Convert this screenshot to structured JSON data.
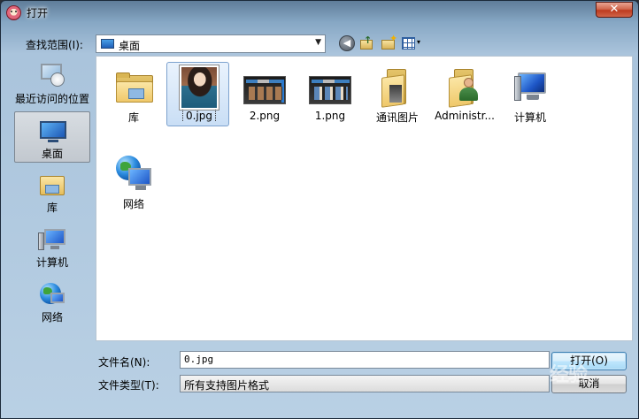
{
  "window": {
    "title": "打开",
    "close_label": "✕"
  },
  "toolbar": {
    "look_in_label": "查找范围(I):",
    "look_in_value": "桌面",
    "back_glyph": "◀",
    "views_dropdown_glyph": "▾"
  },
  "places": [
    {
      "label": "最近访问的位置",
      "icon": "recent-places-icon",
      "selected": false
    },
    {
      "label": "桌面",
      "icon": "desktop-icon",
      "selected": true
    },
    {
      "label": "库",
      "icon": "libraries-icon",
      "selected": false
    },
    {
      "label": "计算机",
      "icon": "computer-icon",
      "selected": false
    },
    {
      "label": "网络",
      "icon": "network-icon",
      "selected": false
    }
  ],
  "files": [
    {
      "label": "库",
      "icon": "libraries-folder-icon"
    },
    {
      "label": "0.jpg",
      "icon": "photo-thumbnail-icon",
      "selected": true
    },
    {
      "label": "2.png",
      "icon": "image-thumbnail-icon"
    },
    {
      "label": "1.png",
      "icon": "image-thumbnail-icon"
    },
    {
      "label": "通讯图片",
      "icon": "folder-icon"
    },
    {
      "label": "Administr...",
      "icon": "user-folder-icon"
    },
    {
      "label": "计算机",
      "icon": "computer-icon"
    },
    {
      "label": "网络",
      "icon": "network-icon"
    }
  ],
  "footer": {
    "filename_label": "文件名(N):",
    "filename_value": "0.jpg",
    "filetype_label": "文件类型(T):",
    "filetype_value": "所有支持图片格式",
    "open_label": "打开(O)",
    "cancel_label": "取消"
  },
  "watermark_text": "经验"
}
